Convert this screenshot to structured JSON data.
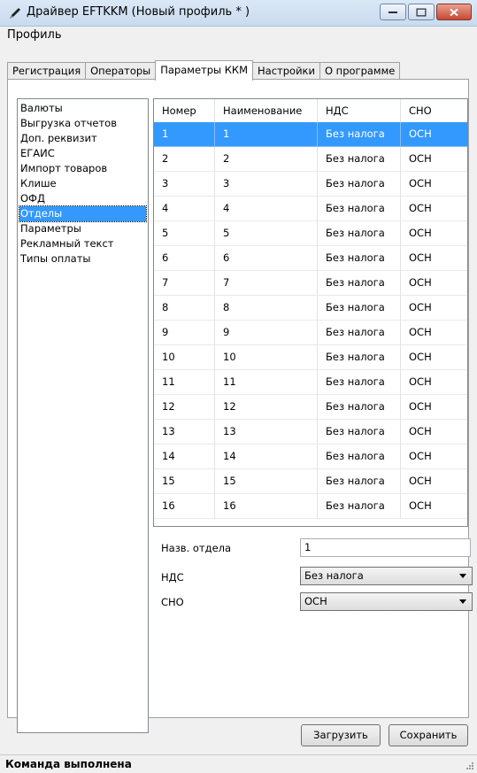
{
  "window": {
    "title": "Драйвер EFTKKM (Новый профиль * )"
  },
  "menu": {
    "profile": "Профиль"
  },
  "tabs": [
    "Регистрация",
    "Операторы",
    "Параметры ККМ",
    "Настройки",
    "О программе"
  ],
  "active_tab": "Параметры ККМ",
  "sidebar": {
    "items": [
      "Валюты",
      "Выгрузка отчетов",
      "Доп. реквизит",
      "ЕГАИС",
      "Импорт товаров",
      "Клише",
      "ОФД",
      "Отделы",
      "Параметры",
      "Рекламный текст",
      "Типы оплаты"
    ],
    "selected": "Отделы"
  },
  "table": {
    "columns": [
      "Номер",
      "Наименование",
      "НДС",
      "СНО"
    ],
    "rows": [
      [
        "1",
        "1",
        "Без налога",
        "ОСН"
      ],
      [
        "2",
        "2",
        "Без налога",
        "ОСН"
      ],
      [
        "3",
        "3",
        "Без налога",
        "ОСН"
      ],
      [
        "4",
        "4",
        "Без налога",
        "ОСН"
      ],
      [
        "5",
        "5",
        "Без налога",
        "ОСН"
      ],
      [
        "6",
        "6",
        "Без налога",
        "ОСН"
      ],
      [
        "7",
        "7",
        "Без налога",
        "ОСН"
      ],
      [
        "8",
        "8",
        "Без налога",
        "ОСН"
      ],
      [
        "9",
        "9",
        "Без налога",
        "ОСН"
      ],
      [
        "10",
        "10",
        "Без налога",
        "ОСН"
      ],
      [
        "11",
        "11",
        "Без налога",
        "ОСН"
      ],
      [
        "12",
        "12",
        "Без налога",
        "ОСН"
      ],
      [
        "13",
        "13",
        "Без налога",
        "ОСН"
      ],
      [
        "14",
        "14",
        "Без налога",
        "ОСН"
      ],
      [
        "15",
        "15",
        "Без налога",
        "ОСН"
      ],
      [
        "16",
        "16",
        "Без налога",
        "ОСН"
      ]
    ],
    "selected_row": 0
  },
  "form": {
    "dept_name_label": "Назв. отдела",
    "dept_name_value": "1",
    "vat_label": "НДС",
    "vat_value": "Без налога",
    "tax_system_label": "СНО",
    "tax_system_value": "ОСН"
  },
  "buttons": {
    "load": "Загрузить",
    "save": "Сохранить"
  },
  "status": {
    "text": "Команда выполнена"
  },
  "colors": {
    "selection": "#3399ff",
    "titlebar": "#c8dbef",
    "close_button": "#c74a32"
  }
}
